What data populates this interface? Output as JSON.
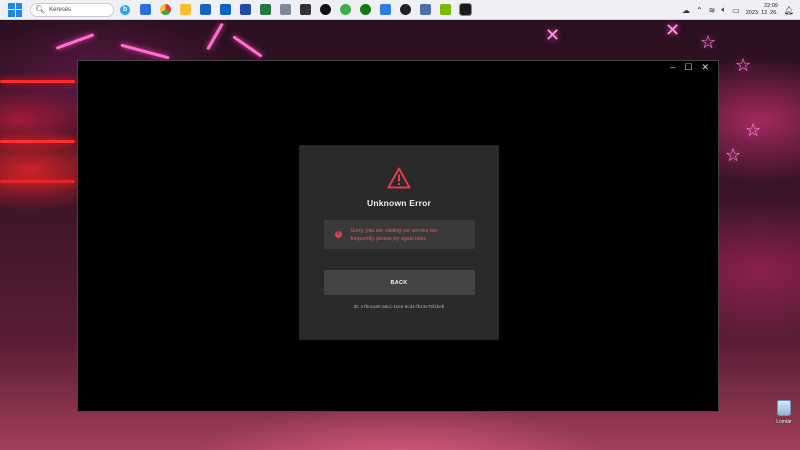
{
  "taskbar": {
    "search_placeholder": "Keresés",
    "clock_time": "22:09",
    "clock_date": "2023. 12. 26."
  },
  "desktop": {
    "recycle_bin_label": "Lomtár"
  },
  "window": {
    "minimize": "–",
    "maximize": "☐",
    "close": "✕"
  },
  "error": {
    "title": "Unknown Error",
    "message": "Sorry, you are visiting our service too frequently, please try again later.",
    "back_label": "BACK",
    "request_id": "ID: e7bcca30-a6cc-11ee-9cd4-fb13e79f1beb",
    "accent_color": "#e23b4a"
  }
}
